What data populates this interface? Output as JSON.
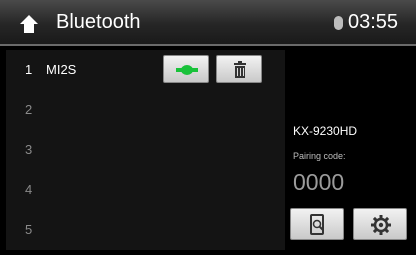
{
  "header": {
    "title": "Bluetooth",
    "time": "03:55",
    "home_icon": "home-icon",
    "status_icon": "bluetooth-status-icon"
  },
  "devices": [
    {
      "number": "1",
      "name": "MI2S"
    },
    {
      "number": "2",
      "name": ""
    },
    {
      "number": "3",
      "name": ""
    },
    {
      "number": "4",
      "name": ""
    },
    {
      "number": "5",
      "name": ""
    }
  ],
  "row_buttons": {
    "connect_icon": "connect-plug-icon",
    "delete_icon": "trash-icon",
    "connect_color": "#19c23a"
  },
  "panel": {
    "device_name": "KX-9230HD",
    "pairing_label": "Pairing code:",
    "pairing_code": "0000",
    "search_icon": "search-device-icon",
    "settings_icon": "gear-icon"
  }
}
